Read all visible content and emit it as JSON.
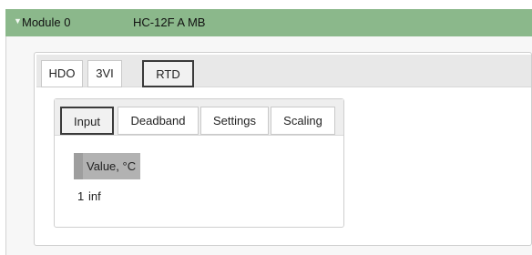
{
  "module": {
    "name": "Module 0",
    "model": "HC-12F A MB"
  },
  "outer_tabs": [
    "HDO",
    "3VI",
    "RTD"
  ],
  "outer_active_tab": "RTD",
  "inner_tabs": [
    "Input",
    "Deadband",
    "Settings",
    "Scaling"
  ],
  "inner_active_tab": "Input",
  "grid": {
    "column_header": "Value, °C",
    "rows": [
      {
        "num": "1",
        "value": "inf"
      }
    ]
  },
  "colors": {
    "module_header": "#8bb88b",
    "tab_strip": "#e8e8e8",
    "grid_header": "#b2b2b2",
    "active_tab_border": "#3a3a3a"
  }
}
